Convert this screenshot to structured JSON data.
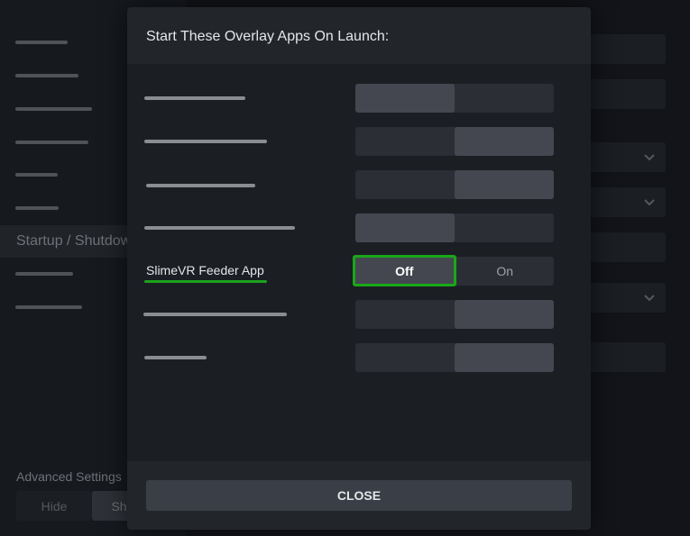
{
  "background": {
    "sidebar": {
      "active_item": "Startup / Shutdown",
      "advanced_settings_label": "Advanced Settings",
      "hide_label": "Hide",
      "show_label": "Sh"
    }
  },
  "dialog": {
    "title": "Start These Overlay Apps On Launch:",
    "apps": [
      {
        "label": "",
        "state": "off",
        "options": [
          "",
          ""
        ]
      },
      {
        "label": "",
        "state": "on",
        "options": [
          "",
          ""
        ]
      },
      {
        "label": "",
        "state": "on",
        "options": [
          "",
          ""
        ]
      },
      {
        "label": "",
        "state": "off",
        "options": [
          "",
          ""
        ]
      },
      {
        "label": "SlimeVR Feeder App",
        "state": "off",
        "focused": true,
        "options": [
          "Off",
          "On"
        ]
      },
      {
        "label": "",
        "state": "on",
        "options": [
          "",
          ""
        ]
      },
      {
        "label": "",
        "state": "on",
        "options": [
          "",
          ""
        ]
      }
    ],
    "close_label": "CLOSE"
  },
  "colors": {
    "focus_outline": "#18a818",
    "active_segment": "#44474f"
  }
}
